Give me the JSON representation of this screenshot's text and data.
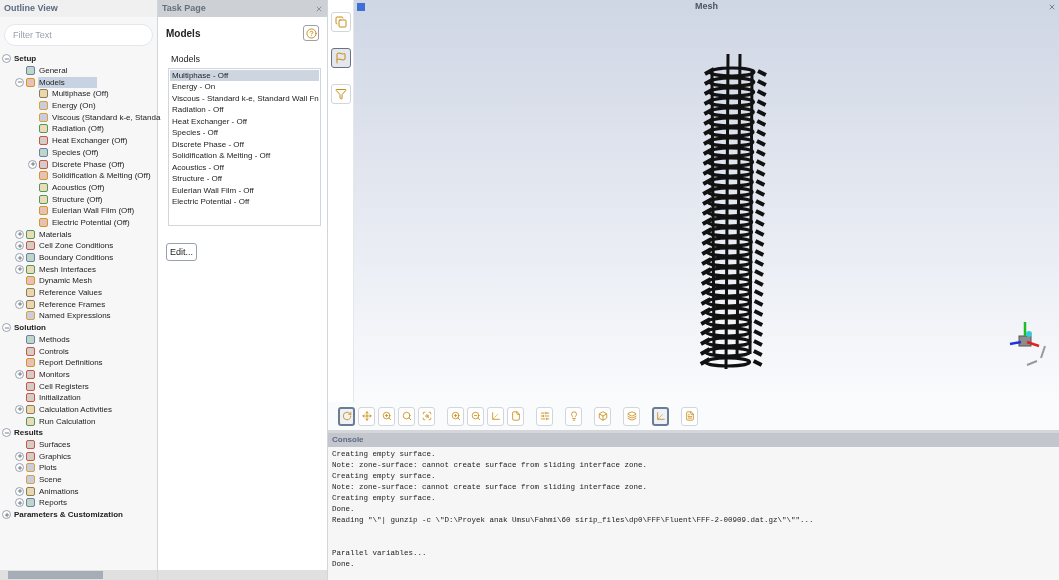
{
  "outline": {
    "title": "Outline View",
    "filter": {
      "placeholder": "Filter Text"
    },
    "tree": [
      {
        "label": "Setup",
        "expanded": true,
        "selected": false,
        "children": [
          {
            "label": "General",
            "selected": false
          },
          {
            "label": "Models",
            "expanded": true,
            "selected": true,
            "children": [
              {
                "label": "Multiphase (Off)",
                "selected": false
              },
              {
                "label": "Energy (On)",
                "selected": false
              },
              {
                "label": "Viscous (Standard k-e, Standa",
                "selected": false
              },
              {
                "label": "Radiation (Off)",
                "selected": false
              },
              {
                "label": "Heat Exchanger (Off)",
                "selected": false
              },
              {
                "label": "Species (Off)",
                "selected": false
              },
              {
                "label": "Discrete Phase (Off)",
                "expanded": false,
                "selected": false
              },
              {
                "label": "Solidification & Melting (Off)",
                "selected": false
              },
              {
                "label": "Acoustics (Off)",
                "selected": false
              },
              {
                "label": "Structure (Off)",
                "selected": false
              },
              {
                "label": "Eulerian Wall Film (Off)",
                "selected": false
              },
              {
                "label": "Electric Potential (Off)",
                "selected": false
              }
            ]
          },
          {
            "label": "Materials",
            "expanded": false,
            "selected": false
          },
          {
            "label": "Cell Zone Conditions",
            "expanded": false,
            "selected": false
          },
          {
            "label": "Boundary Conditions",
            "expanded": false,
            "selected": false
          },
          {
            "label": "Mesh Interfaces",
            "expanded": false,
            "selected": false
          },
          {
            "label": "Dynamic Mesh",
            "selected": false
          },
          {
            "label": "Reference Values",
            "selected": false
          },
          {
            "label": "Reference Frames",
            "expanded": false,
            "selected": false
          },
          {
            "label": "Named Expressions",
            "selected": false
          }
        ]
      },
      {
        "label": "Solution",
        "expanded": true,
        "selected": false,
        "children": [
          {
            "label": "Methods",
            "selected": false
          },
          {
            "label": "Controls",
            "selected": false
          },
          {
            "label": "Report Definitions",
            "selected": false
          },
          {
            "label": "Monitors",
            "expanded": false,
            "selected": false
          },
          {
            "label": "Cell Registers",
            "selected": false
          },
          {
            "label": "Initialization",
            "selected": false
          },
          {
            "label": "Calculation Activities",
            "expanded": false,
            "selected": false
          },
          {
            "label": "Run Calculation",
            "selected": false
          }
        ]
      },
      {
        "label": "Results",
        "expanded": true,
        "selected": false,
        "children": [
          {
            "label": "Surfaces",
            "selected": false
          },
          {
            "label": "Graphics",
            "expanded": false,
            "selected": false
          },
          {
            "label": "Plots",
            "expanded": false,
            "selected": false
          },
          {
            "label": "Scene",
            "selected": false
          },
          {
            "label": "Animations",
            "expanded": false,
            "selected": false
          },
          {
            "label": "Reports",
            "expanded": false,
            "selected": false
          }
        ]
      },
      {
        "label": "Parameters & Customization",
        "expanded": false,
        "selected": false
      }
    ]
  },
  "task_page": {
    "title": "Task Page",
    "heading": "Models",
    "group_label": "Models",
    "models": [
      {
        "label": "Multiphase - Off",
        "selected": true
      },
      {
        "label": "Energy - On",
        "selected": false
      },
      {
        "label": "Viscous - Standard k-e, Standard Wall Fn",
        "selected": false
      },
      {
        "label": "Radiation - Off",
        "selected": false
      },
      {
        "label": "Heat Exchanger - Off",
        "selected": false
      },
      {
        "label": "Species - Off",
        "selected": false
      },
      {
        "label": "Discrete Phase - Off",
        "selected": false
      },
      {
        "label": "Solidification & Melting - Off",
        "selected": false
      },
      {
        "label": "Acoustics - Off",
        "selected": false
      },
      {
        "label": "Structure - Off",
        "selected": false
      },
      {
        "label": "Eulerian Wall Film - Off",
        "selected": false
      },
      {
        "label": "Electric Potential - Off",
        "selected": false
      }
    ],
    "edit_button": "Edit..."
  },
  "side_toolbar": [
    {
      "selected": false
    },
    {
      "selected": true
    },
    {
      "selected": false
    }
  ],
  "viewer": {
    "title": "Mesh",
    "toolbar": [
      {
        "selected": true
      },
      {
        "selected": false
      },
      {
        "selected": false
      },
      {
        "selected": false
      },
      {
        "selected": false
      },
      {
        "selected": false
      },
      {
        "selected": false
      },
      {
        "selected": false
      },
      {
        "selected": false
      },
      {
        "selected": false
      },
      {
        "selected": false
      },
      {
        "selected": false
      },
      {
        "selected": false
      },
      {
        "selected": true
      },
      {
        "selected": false
      }
    ]
  },
  "console": {
    "title": "Console",
    "blocks": [
      [
        "Creating empty surface.",
        "Note: zone-surface: cannot create surface from sliding interface zone.",
        "Creating empty surface.",
        "Note: zone-surface: cannot create surface from sliding interface zone.",
        "Creating empty surface.",
        "Done.",
        "Reading \"\\\"| gunzip -c \\\"D:\\Proyek anak Umsu\\Fahmi\\60 sirip_files\\dp0\\FFF\\Fluent\\FFF-2-00909.dat.gz\\\"\\\"\"..."
      ],
      [
        "Parallel variables...",
        "Done."
      ]
    ]
  }
}
